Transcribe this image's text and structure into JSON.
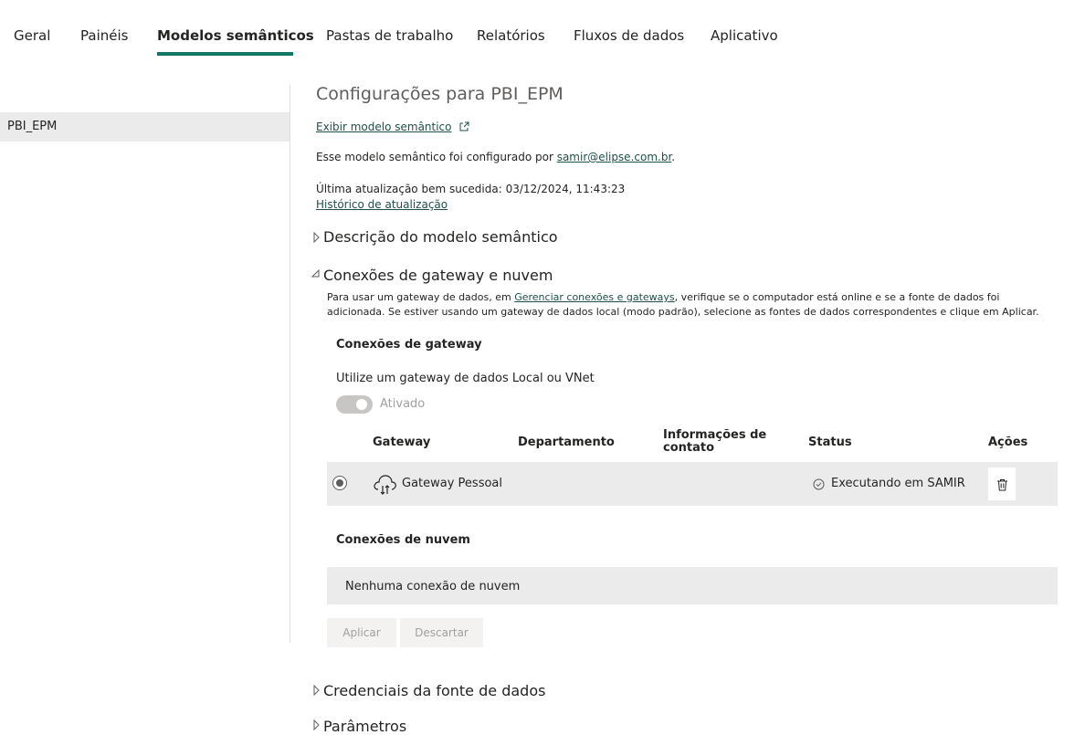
{
  "tabs": [
    {
      "label": "Geral"
    },
    {
      "label": "Painéis"
    },
    {
      "label": "Modelos semânticos"
    },
    {
      "label": "Pastas de trabalho"
    },
    {
      "label": "Relatórios"
    },
    {
      "label": "Fluxos de dados"
    },
    {
      "label": "Aplicativo"
    }
  ],
  "active_tab": "Modelos semânticos",
  "accent_color": "#117865",
  "sidebar": {
    "items": [
      {
        "label": "PBI_EPM",
        "selected": true
      }
    ]
  },
  "main": {
    "title": "Configurações para PBI_EPM",
    "view_model_link": "Exibir modelo semântico",
    "configured_by_prefix": "Esse modelo semântico foi configurado por ",
    "configured_by_email": "samir@elipse.com.br",
    "configured_by_suffix": ".",
    "last_refresh": "Última atualização bem sucedida: 03/12/2024, 11:43:23",
    "refresh_history_link": "Histórico de atualização",
    "sections": {
      "description": {
        "label": "Descrição do modelo semântico",
        "expanded": false
      },
      "gateway": {
        "label": "Conexões de gateway e nuvem",
        "expanded": true
      },
      "credentials": {
        "label": "Credenciais da fonte de dados",
        "expanded": false
      },
      "parameters": {
        "label": "Parâmetros",
        "expanded": false
      }
    },
    "gateway_info": {
      "text_before": "Para usar um gateway de dados, em ",
      "link": "Gerenciar conexões e gateways",
      "text_after": ", verifique se o computador está online e se a fonte de dados foi adicionada. Se estiver usando um gateway de dados local (modo padrão), selecione as fontes de dados correspondentes e clique em Aplicar."
    },
    "gateway_connections": {
      "heading": "Conexões de gateway",
      "toggle_label": "Utilize um gateway de dados Local ou VNet",
      "toggle_state": "Ativado",
      "toggle_on": true,
      "columns": [
        "Gateway",
        "Departamento",
        "Informações de contato",
        "Status",
        "Ações"
      ],
      "rows": [
        {
          "gateway": "Gateway Pessoal",
          "department": "",
          "contact": "",
          "status": "Executando em SAMIR",
          "selected": true,
          "icon": "cloud-gateway-icon"
        }
      ]
    },
    "cloud_connections": {
      "heading": "Conexões de nuvem",
      "empty_text": "Nenhuma conexão de nuvem"
    },
    "buttons": {
      "apply": "Aplicar",
      "discard": "Descartar"
    }
  }
}
